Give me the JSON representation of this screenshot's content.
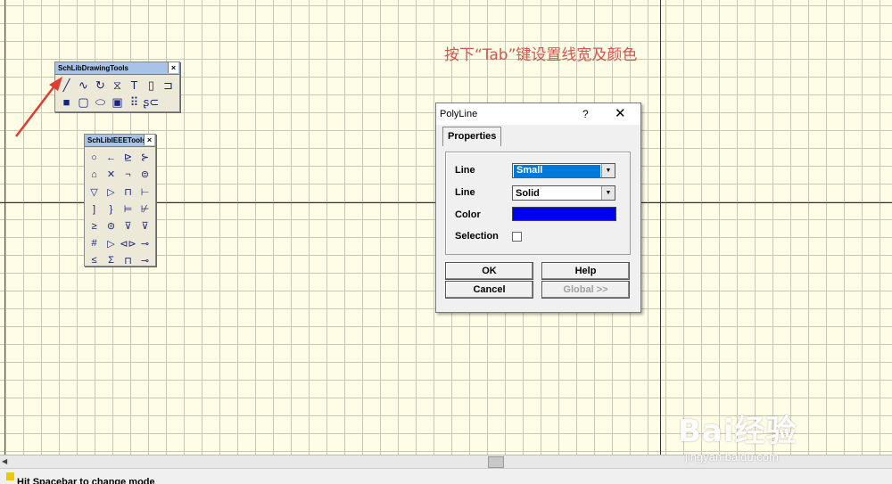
{
  "annotation": "按下“Tab”键设置线宽及颜色",
  "palettes": {
    "drawing": {
      "title": "SchLibDrawingTools",
      "close": "×",
      "tools": [
        {
          "icon": "line-icon",
          "glyph": "╱"
        },
        {
          "icon": "bezier-icon",
          "glyph": "∿"
        },
        {
          "icon": "arc-icon",
          "glyph": "↻"
        },
        {
          "icon": "polygon-icon",
          "glyph": "⧖"
        },
        {
          "icon": "text-icon",
          "glyph": "T"
        },
        {
          "icon": "part-icon",
          "glyph": "▯"
        },
        {
          "icon": "pin-icon",
          "glyph": "⊐"
        },
        {
          "icon": "rectangle-icon",
          "glyph": "■"
        },
        {
          "icon": "rounded-rectangle-icon",
          "glyph": "▢"
        },
        {
          "icon": "ellipse-icon",
          "glyph": "⬭"
        },
        {
          "icon": "image-icon",
          "glyph": "▣"
        },
        {
          "icon": "array-paste-icon",
          "glyph": "⠿"
        },
        {
          "icon": "ieee-symbols-icon",
          "glyph": "ʂ⊂"
        }
      ]
    },
    "ieee": {
      "title": "SchLibIEEETools",
      "close": "×",
      "tools": [
        "○",
        "←",
        "⊵",
        "⊱",
        "⌂",
        "✕",
        "¬",
        "⊜",
        "▽",
        "▷",
        "⊓",
        "⊢",
        "]",
        "}",
        "⊨",
        "⊬",
        "≥",
        "⊜",
        "⊽",
        "⊽",
        "#",
        "▷",
        "⊲⊳",
        "⊸",
        "≤",
        "Σ",
        "⊓",
        "⊸"
      ]
    }
  },
  "dialog": {
    "title": "PolyLine",
    "help_glyph": "?",
    "close_glyph": "✕",
    "tab": "Properties",
    "fields": {
      "line_width": {
        "label": "Line",
        "value": "Small"
      },
      "line_style": {
        "label": "Line",
        "value": "Solid"
      },
      "color": {
        "label": "Color",
        "value": "#0000f0"
      },
      "selection": {
        "label": "Selection",
        "checked": false
      }
    },
    "buttons": {
      "ok": "OK",
      "help": "Help",
      "cancel": "Cancel",
      "global": "Global >>"
    }
  },
  "status": {
    "text": "Hit Spacebar to change mode"
  },
  "watermark": {
    "logo": "Bai经验",
    "url": "jingyan.baidu.com"
  },
  "colors": {
    "grid_bg": "#fffde6",
    "annotation": "#d9534f",
    "selection": "#0078d7",
    "palette_title": "#a7c4e8"
  }
}
